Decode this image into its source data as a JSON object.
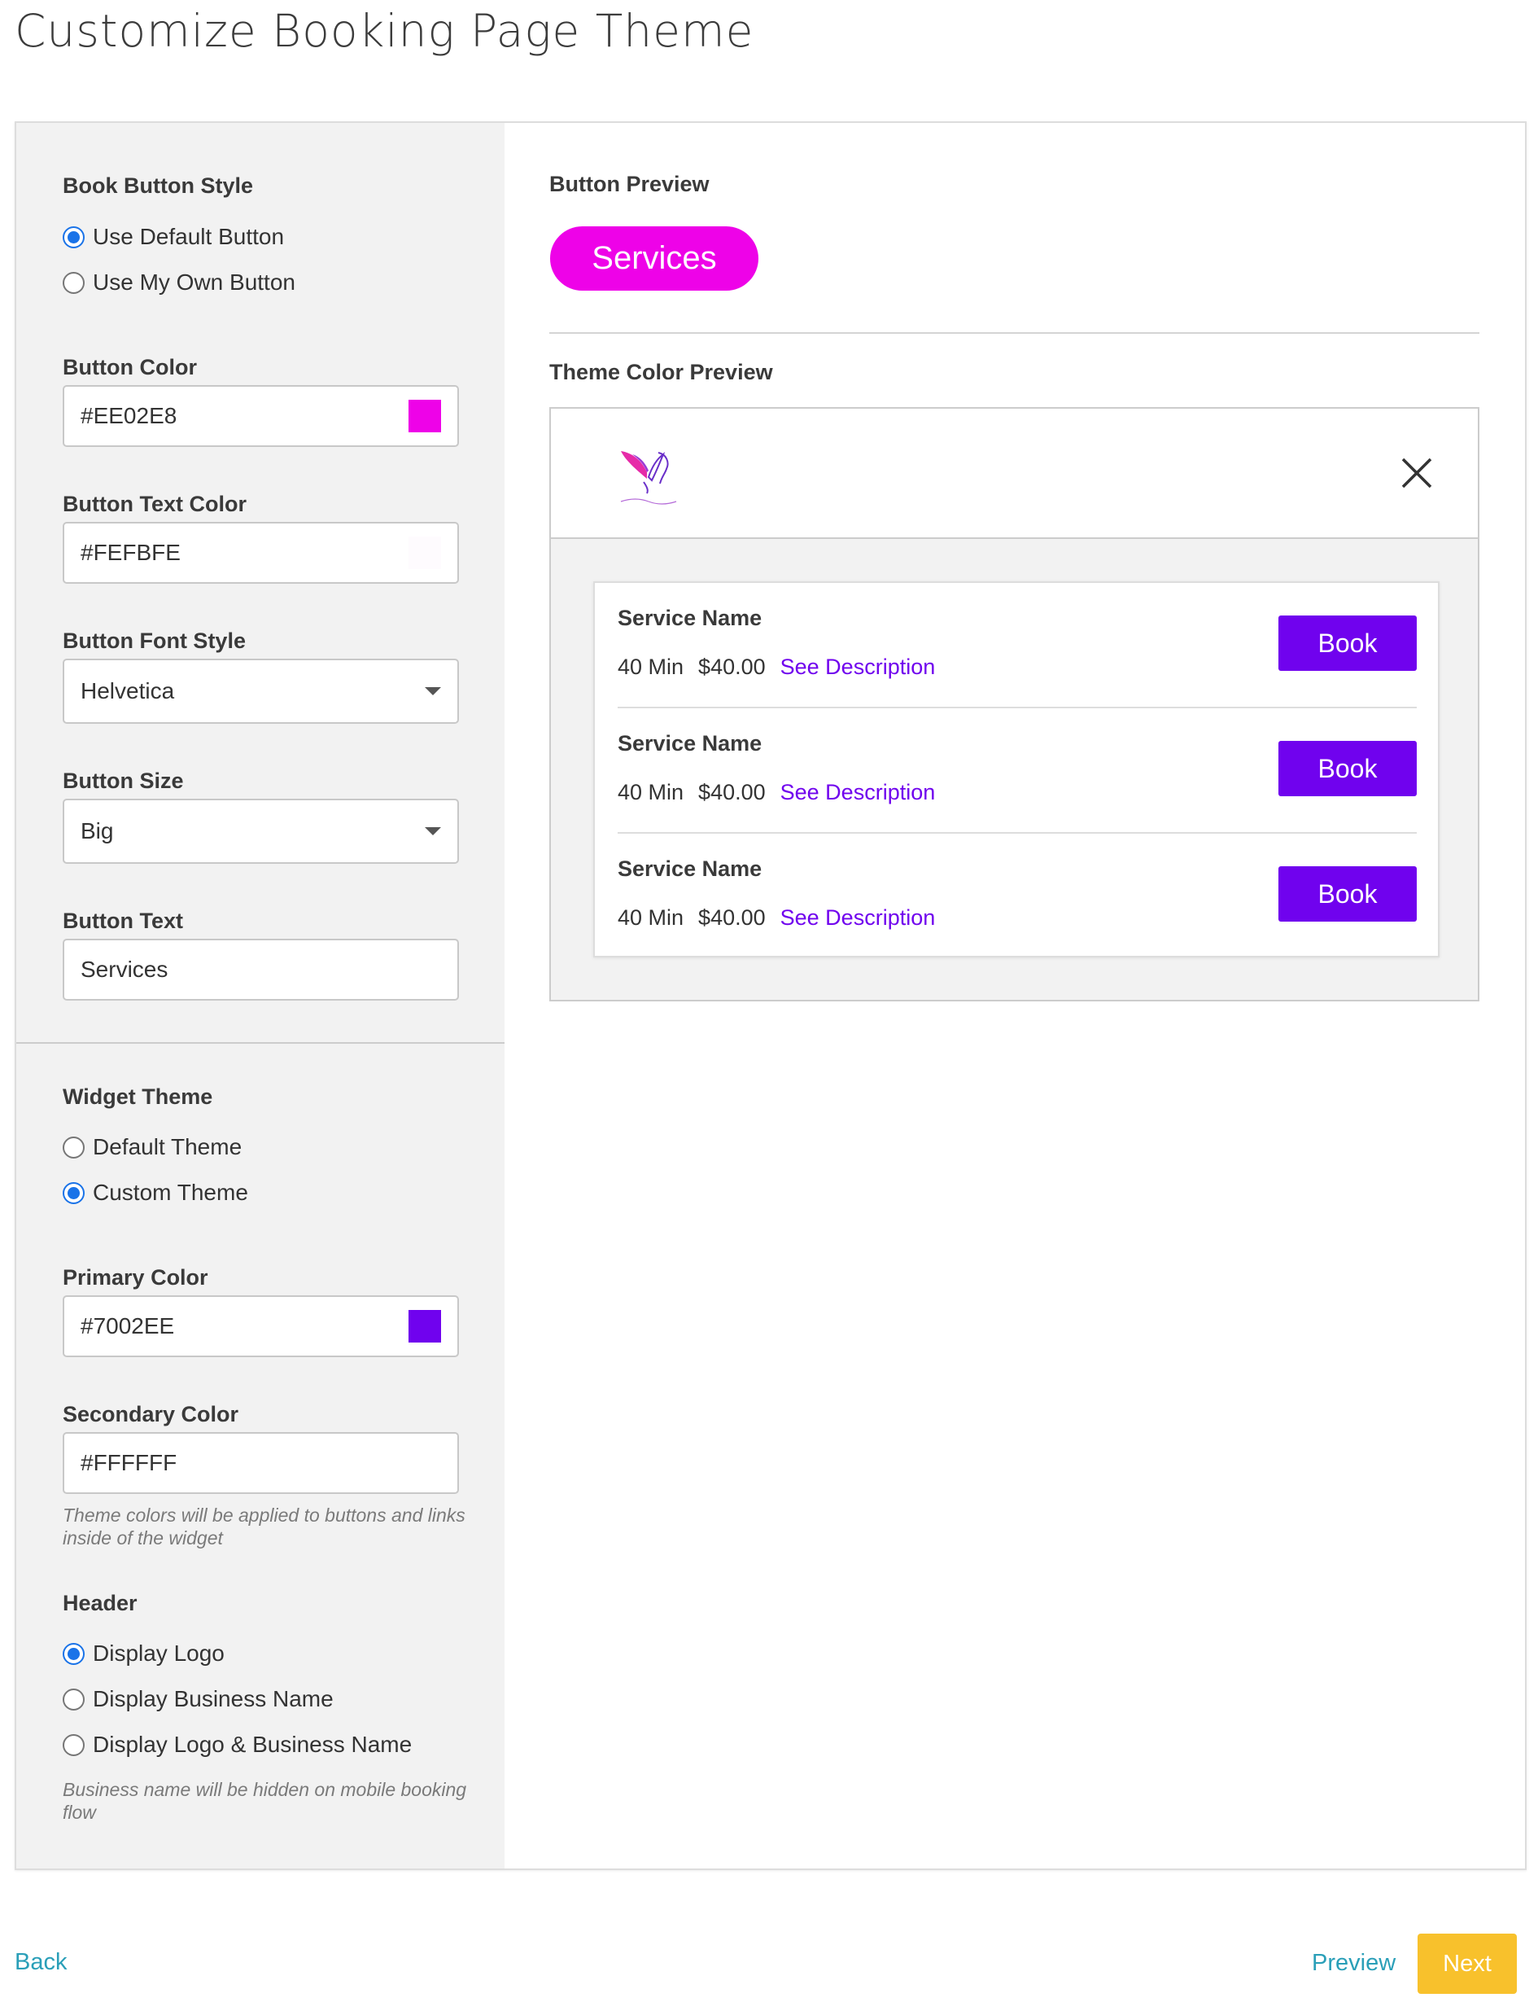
{
  "page": {
    "title": "Customize Booking Page Theme"
  },
  "colors": {
    "button_color": "#EE02E8",
    "button_text_color": "#FEFBFE",
    "primary_color": "#7002EE",
    "secondary_color": "#FFFFFF",
    "footer_link": "#2a9fb8",
    "next_button": "#f8c12c",
    "radio_accent": "#1a73e8"
  },
  "left_panel": {
    "book_button_style": {
      "label": "Book Button Style",
      "options": [
        "Use Default Button",
        "Use My Own Button"
      ],
      "selected": "Use Default Button"
    },
    "button_color": {
      "label": "Button Color",
      "value": "#EE02E8"
    },
    "button_text_color": {
      "label": "Button Text Color",
      "value": "#FEFBFE"
    },
    "button_font_style": {
      "label": "Button Font Style",
      "value": "Helvetica"
    },
    "button_size": {
      "label": "Button Size",
      "value": "Big"
    },
    "button_text": {
      "label": "Button Text",
      "value": "Services"
    },
    "widget_theme": {
      "label": "Widget Theme",
      "options": [
        "Default Theme",
        "Custom Theme"
      ],
      "selected": "Custom Theme"
    },
    "primary_color": {
      "label": "Primary Color",
      "value": "#7002EE"
    },
    "secondary_color": {
      "label": "Secondary Color",
      "value": "#FFFFFF"
    },
    "theme_hint": "Theme colors will be applied to buttons and links inside of the widget",
    "header": {
      "label": "Header",
      "options": [
        "Display Logo",
        "Display Business Name",
        "Display Logo & Business Name"
      ],
      "selected": "Display Logo"
    },
    "header_hint": "Business name will be hidden on mobile booking flow"
  },
  "preview": {
    "button_preview_label": "Button Preview",
    "button_preview_text": "Services",
    "theme_preview_label": "Theme Color Preview",
    "services": [
      {
        "name": "Service Name",
        "duration": "40 Min",
        "price": "$40.00",
        "link": "See Description",
        "button": "Book"
      },
      {
        "name": "Service Name",
        "duration": "40 Min",
        "price": "$40.00",
        "link": "See Description",
        "button": "Book"
      },
      {
        "name": "Service Name",
        "duration": "40 Min",
        "price": "$40.00",
        "link": "See Description",
        "button": "Book"
      }
    ]
  },
  "footer": {
    "back": "Back",
    "preview": "Preview",
    "next": "Next"
  }
}
